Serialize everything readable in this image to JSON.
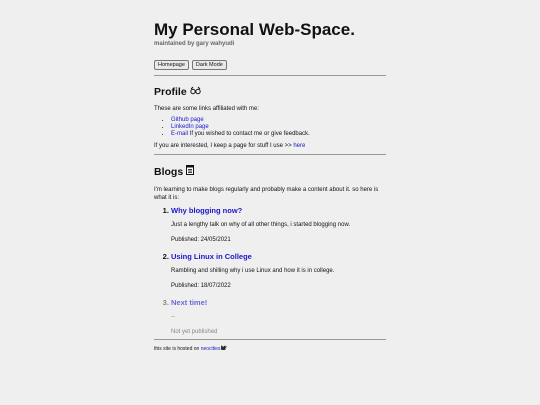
{
  "header": {
    "title": "My Personal Web-Space.",
    "subtitle": "maintained by gary wahyudi"
  },
  "buttons": {
    "homepage": "Homepage",
    "dark_mode": "Dark Mode"
  },
  "profile": {
    "heading": "Profile",
    "heading_icon": "glasses-icon",
    "intro": "These are some links affiliated with me:",
    "links": [
      {
        "label": "Github page",
        "suffix": ""
      },
      {
        "label": "LinkedIn page",
        "suffix": ""
      },
      {
        "label": "E-mail",
        "suffix": " If you wished to contact me or give feedback."
      }
    ],
    "more_prefix": "If you are interested, I keep a page for stuff I use >> ",
    "more_link": "here"
  },
  "blogs": {
    "heading": "Blogs",
    "heading_icon": "notepad-icon",
    "intro": "I'm learning to make blogs regularly and probably make a content about it. so here is what it is:",
    "posts": [
      {
        "title": "Why blogging now?",
        "body": "Just a lengthy talk on why of all other things, i started blogging now.",
        "date": "Published: 24/05/2021"
      },
      {
        "title": "Using Linux in College",
        "body": "Rambling and shilling why i use Linux and how it is in college.",
        "date": "Published: 18/07/2022"
      },
      {
        "title": "Next time!",
        "body": "--",
        "date": "Not yet published"
      }
    ]
  },
  "footer": {
    "prefix": "this site is hosted on ",
    "link": "neocities",
    "icon": "cat-icon"
  },
  "colors": {
    "link": "#1a17c9",
    "background": "#efefef"
  }
}
